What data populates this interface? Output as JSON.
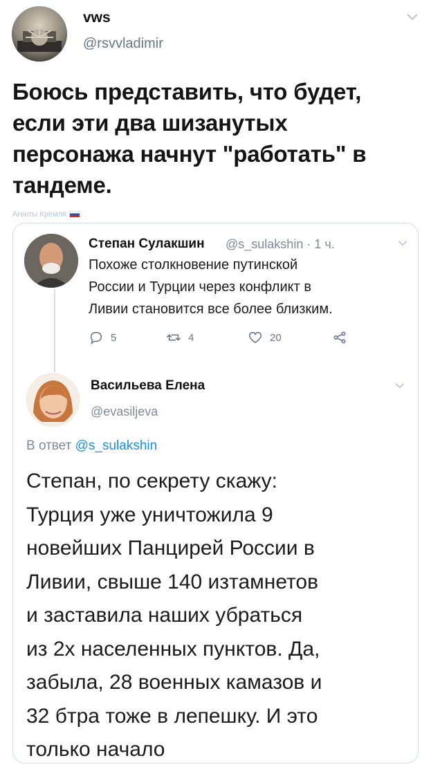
{
  "outer_tweet": {
    "name": "vws",
    "handle": "@rsvvladimir",
    "text": "Боюсь представить, что будет,\nесли эти два шизанутых\nперсонажа начнут \"работать\" в\nтандеме.",
    "watermark": "Агенты Кремля"
  },
  "quoted_tweet": {
    "name": "Степан Сулакшин",
    "handle_time": "@s_sulakshin · 1 ч.",
    "text": "Похоже столкновение путинской\nРоссии и Турции через конфликт в\nЛивии становится все более близким.",
    "actions": {
      "replies": "5",
      "retweets": "4",
      "likes": "20"
    }
  },
  "reply_tweet": {
    "name": "Васильева Елена",
    "handle": "@evasiljeva",
    "reply_prefix": "В ответ",
    "reply_to": "@s_sulakshin",
    "text": "Степан, по секрету скажу:\nТурция уже уничтожила 9\nновейших Панцирей России в\nЛивии, свыше 140 изтамнетов\nи заставила наших убраться\nиз 2х населенных пунктов. Да,\nзабыла, 28 военных камазов и\n32 бтра тоже в лепешку. И это\nтолько начало"
  },
  "colors": {
    "text": "#111111",
    "muted": "#657786",
    "link": "#1d8fe0",
    "border": "#d6dde4"
  },
  "icons": [
    "chevron-down-icon",
    "reply-icon",
    "retweet-icon",
    "like-icon",
    "share-icon"
  ]
}
